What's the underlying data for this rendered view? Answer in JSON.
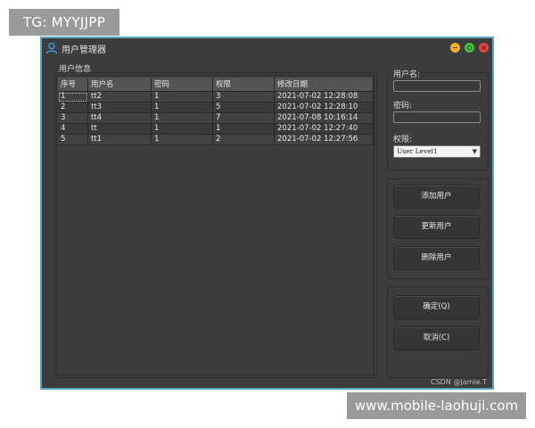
{
  "watermark_top": "TG: MYYJJPP",
  "watermark_bottom": "www.mobile-laohuji.com",
  "window": {
    "title": "用户管理器",
    "icon": "user-icon",
    "controls": [
      "minimize-icon",
      "maximize-icon",
      "close-icon"
    ],
    "border_color": "#5aa3c7"
  },
  "user_info": {
    "group_title": "用户信息",
    "columns": [
      "序号",
      "用户名",
      "密码",
      "权限",
      "修改日期"
    ],
    "rows": [
      {
        "id": "1",
        "username": "tt2",
        "password": "1",
        "level": "3",
        "date": "2021-07-02 12:28:08"
      },
      {
        "id": "2",
        "username": "tt3",
        "password": "1",
        "level": "5",
        "date": "2021-07-02 12:28:10"
      },
      {
        "id": "3",
        "username": "tt4",
        "password": "1",
        "level": "7",
        "date": "2021-07-08 10:16:14"
      },
      {
        "id": "4",
        "username": "tt",
        "password": "1",
        "level": "1",
        "date": "2021-07-02 12:27:40"
      },
      {
        "id": "5",
        "username": "tt1",
        "password": "1",
        "level": "2",
        "date": "2021-07-02 12:27:56"
      }
    ]
  },
  "form": {
    "username_label": "用户名:",
    "password_label": "密码:",
    "level_label": "权限:",
    "level_selected": "User Level1"
  },
  "actions": {
    "add": "添加用户",
    "update": "更新用户",
    "delete": "删除用户",
    "ok": "确定(Q)",
    "cancel": "取消(C)"
  },
  "credit": "CSDN @Jamie.T"
}
